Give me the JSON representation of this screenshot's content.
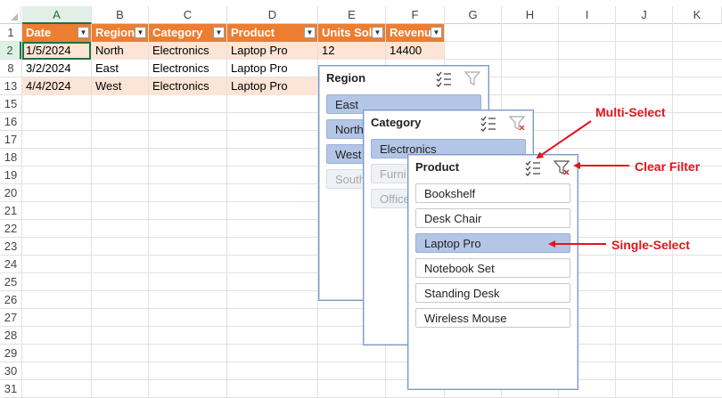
{
  "sheet": {
    "columns": [
      "A",
      "B",
      "C",
      "D",
      "E",
      "F",
      "G",
      "H",
      "I",
      "J",
      "K"
    ],
    "rows": [
      "1",
      "2",
      "8",
      "13",
      "15",
      "16",
      "17",
      "18",
      "19",
      "20",
      "21",
      "22",
      "23",
      "24",
      "25",
      "26",
      "27",
      "28",
      "29",
      "30",
      "31"
    ],
    "header": [
      "Date",
      "Region",
      "Category",
      "Product",
      "Units Sol",
      "Revenu"
    ],
    "data": [
      [
        "1/5/2024",
        "North",
        "Electronics",
        "Laptop Pro",
        "12",
        "14400"
      ],
      [
        "3/2/2024",
        "East",
        "Electronics",
        "Laptop Pro",
        "",
        ""
      ],
      [
        "4/4/2024",
        "West",
        "Electronics",
        "Laptop Pro",
        "",
        ""
      ]
    ]
  },
  "slicer_region": {
    "title": "Region",
    "items": [
      "East",
      "North",
      "West",
      "South"
    ]
  },
  "slicer_category": {
    "title": "Category",
    "items": [
      "Electronics",
      "Furni",
      "Office"
    ]
  },
  "slicer_product": {
    "title": "Product",
    "items": [
      "Bookshelf",
      "Desk Chair",
      "Laptop Pro",
      "Notebook Set",
      "Standing Desk",
      "Wireless Mouse"
    ]
  },
  "annotations": {
    "multi_select": "Multi-Select",
    "clear_filter": "Clear Filter",
    "single_select": "Single-Select"
  },
  "colors": {
    "header_fill": "#ed7d31",
    "band_fill": "#fce4d6",
    "slicer_selected": "#b4c6e7",
    "annotation": "#e4141c"
  },
  "icons": {
    "multi_select": "multi-select-icon",
    "clear_filter": "clear-filter-icon",
    "filter_dropdown": "filter-dropdown-icon"
  }
}
